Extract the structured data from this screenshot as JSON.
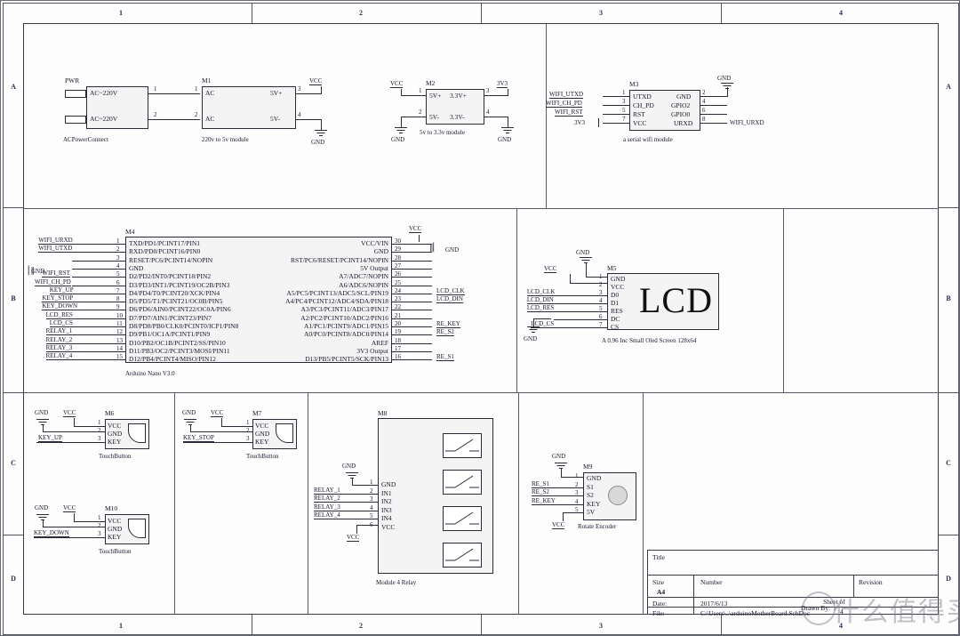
{
  "sheet": {
    "columns": [
      "1",
      "2",
      "3",
      "4"
    ],
    "rows": [
      "A",
      "B",
      "C",
      "D"
    ]
  },
  "blocks": {
    "ac_connector": {
      "refdes": "PWR",
      "caption": "ACPowerConnect",
      "pins": [
        {
          "num": "1",
          "name": "AC~220V"
        },
        {
          "num": "2",
          "name": "AC~220V"
        }
      ]
    },
    "psu_5v": {
      "refdes": "M1",
      "caption": "220v to 5v module",
      "left_pins": [
        {
          "num": "1",
          "name": "AC"
        },
        {
          "num": "2",
          "name": "AC"
        }
      ],
      "right_pins": [
        {
          "num": "3",
          "name": "5V+"
        },
        {
          "num": "4",
          "name": "5V-"
        }
      ],
      "nets": {
        "vcc": "VCC",
        "gnd": "GND"
      }
    },
    "psu_33v": {
      "refdes": "M2",
      "caption": "5v to 3.3v module",
      "left_pins": [
        {
          "num": "1",
          "name": "5V+"
        },
        {
          "num": "2",
          "name": "5V-"
        }
      ],
      "right_pins": [
        {
          "num": "3",
          "name": "3.3V+"
        },
        {
          "num": "4",
          "name": "3.3V-"
        }
      ],
      "nets": {
        "vcc": "VCC",
        "gnd_left": "GND",
        "v33": "3V3",
        "gnd_right": "GND"
      }
    },
    "wifi": {
      "refdes": "M3",
      "caption": "a serial wifi module",
      "left_pins": [
        {
          "num": "1",
          "name": "UTXD",
          "net": "WIFI_UTXD"
        },
        {
          "num": "3",
          "name": "CH_PD",
          "net": "WIFI_CH_PD"
        },
        {
          "num": "5",
          "name": "RST",
          "net": "WIFI_RST"
        },
        {
          "num": "7",
          "name": "VCC",
          "net": "3V3"
        }
      ],
      "right_pins": [
        {
          "num": "2",
          "name": "GND",
          "net": "GND"
        },
        {
          "num": "4",
          "name": "GPIO2",
          "net": ""
        },
        {
          "num": "6",
          "name": "GPIO0",
          "net": ""
        },
        {
          "num": "8",
          "name": "URXD",
          "net": "WIFI_URXD"
        }
      ]
    },
    "arduino": {
      "refdes": "M4",
      "caption": "Arduino Nano V3.0",
      "left_pins": [
        {
          "num": "1",
          "name": "TXD/PD1/PCINT17/PIN1",
          "net": "WIFI_URXD"
        },
        {
          "num": "2",
          "name": "RXD/PD0/PCINT16/PIN0",
          "net": "WIFI_UTXD"
        },
        {
          "num": "3",
          "name": "RESET/PC6/PCINT14/NOPIN",
          "net": ""
        },
        {
          "num": "4",
          "name": "GND",
          "net": ""
        },
        {
          "num": "5",
          "name": "D2/PD2/INT0/PCINT18/PIN2",
          "net": "WIFI_RST"
        },
        {
          "num": "6",
          "name": "D3/PD3/INT1/PCINT19/OC2B/PIN3",
          "net": "WIFI_CH_PD"
        },
        {
          "num": "7",
          "name": "D4/PD4/T0/PCINT20/XCK/PIN4",
          "net": "KEY_UP"
        },
        {
          "num": "8",
          "name": "D5/PD5/T1/PCINT21/OC0B/PIN5",
          "net": "KEY_STOP"
        },
        {
          "num": "9",
          "name": "D6/PD6/AIN0/PCINT22/OC0A/PIN6",
          "net": "KEY_DOWN"
        },
        {
          "num": "10",
          "name": "D7/PD7/AIN1/PCINT23/PIN7",
          "net": "LCD_RES"
        },
        {
          "num": "11",
          "name": "D8/PD8/PB0/CLK0/PCINT0/ICP1/PIN8",
          "net": "LCD_CS"
        },
        {
          "num": "12",
          "name": "D9/PB1/OC1A/PCINT1/PIN9",
          "net": "RELAY_1"
        },
        {
          "num": "13",
          "name": "D10/PB2/OC1B/PCINT2/SS/PIN10",
          "net": "RELAY_2"
        },
        {
          "num": "14",
          "name": "D11/PB3/OC2/PCINT3/MOSI/PIN11",
          "net": "RELAY_3"
        },
        {
          "num": "15",
          "name": "D12/PB4/PCINT4/MISO/PIN12",
          "net": "RELAY_4"
        }
      ],
      "right_pins": [
        {
          "num": "30",
          "name": "VCC/VIN",
          "net": "VCC"
        },
        {
          "num": "29",
          "name": "GND",
          "net": "GND"
        },
        {
          "num": "28",
          "name": "RST/PC6/RESET/PCINT14/NOPIN",
          "net": ""
        },
        {
          "num": "27",
          "name": "5V Output",
          "net": ""
        },
        {
          "num": "26",
          "name": "A7/ADC7/NOPIN",
          "net": ""
        },
        {
          "num": "25",
          "name": "A6/ADC6/NOPIN",
          "net": ""
        },
        {
          "num": "24",
          "name": "A5/PC5/PCINT13/ADC5/SCL/PIN19",
          "net": "LCD_CLK"
        },
        {
          "num": "23",
          "name": "A4/PC4/PCINT12/ADC4/SDA/PIN18",
          "net": "LCD_DIN"
        },
        {
          "num": "22",
          "name": "A3/PC3/PCINT11/ADC3/PIN17",
          "net": ""
        },
        {
          "num": "21",
          "name": "A2/PC2/PCINT10/ADC2/PIN16",
          "net": ""
        },
        {
          "num": "20",
          "name": "A1/PC1/PCINT9/ADC1/PIN15",
          "net": "RE_KEY"
        },
        {
          "num": "19",
          "name": "A0/PC0/PCINT8/ADC0/PIN14",
          "net": "RE_S2"
        },
        {
          "num": "18",
          "name": "AREF",
          "net": ""
        },
        {
          "num": "17",
          "name": "3V3 Output",
          "net": ""
        },
        {
          "num": "16",
          "name": "D13/PB5/PCINT5/SCK/PIN13",
          "net": "RE_S1"
        }
      ],
      "left_port_net": "GND"
    },
    "lcd": {
      "refdes": "M5",
      "caption": "A 0.96 Inc Small Oled Screen 128x64",
      "display_text": "LCD",
      "pins": [
        {
          "num": "1",
          "name": "GND",
          "net": "GND"
        },
        {
          "num": "2",
          "name": "VCC",
          "net": "VCC"
        },
        {
          "num": "3",
          "name": "D0",
          "net": "LCD_CLK"
        },
        {
          "num": "4",
          "name": "D1",
          "net": "LCD_DIN"
        },
        {
          "num": "5",
          "name": "RES",
          "net": "LCD_RES"
        },
        {
          "num": "6",
          "name": "DC",
          "net": ""
        },
        {
          "num": "7",
          "name": "CS",
          "net": "LCD_CS"
        }
      ],
      "gnd_bottom": "GND"
    },
    "key_up": {
      "refdes": "M6",
      "caption": "TouchButton",
      "nets": {
        "gnd": "GND",
        "vcc": "VCC",
        "key": "KEY_UP"
      },
      "pins": [
        {
          "num": "1",
          "name": "VCC"
        },
        {
          "num": "2",
          "name": "GND"
        },
        {
          "num": "3",
          "name": "KEY"
        }
      ]
    },
    "key_stop": {
      "refdes": "M7",
      "caption": "TouchButton",
      "nets": {
        "gnd": "GND",
        "vcc": "VCC",
        "key": "KEY_STOP"
      },
      "pins": [
        {
          "num": "1",
          "name": "VCC"
        },
        {
          "num": "2",
          "name": "GND"
        },
        {
          "num": "3",
          "name": "KEY"
        }
      ]
    },
    "key_down": {
      "refdes": "M10",
      "caption": "TouchButton",
      "nets": {
        "gnd": "GND",
        "vcc": "VCC",
        "key": "KEY_DOWN"
      },
      "pins": [
        {
          "num": "1",
          "name": "VCC"
        },
        {
          "num": "2",
          "name": "GND"
        },
        {
          "num": "3",
          "name": "KEY"
        }
      ]
    },
    "relay": {
      "refdes": "M8",
      "caption": "Module 4 Relay",
      "gnd_label": "GND",
      "vcc_label": "VCC",
      "pins": [
        {
          "num": "1",
          "name": "GND",
          "net": ""
        },
        {
          "num": "2",
          "name": "IN1",
          "net": "RELAY_1"
        },
        {
          "num": "3",
          "name": "IN2",
          "net": "RELAY_2"
        },
        {
          "num": "4",
          "name": "IN3",
          "net": "RELAY_3"
        },
        {
          "num": "5",
          "name": "IN4",
          "net": "RELAY_4"
        },
        {
          "num": "6",
          "name": "VCC",
          "net": ""
        }
      ],
      "relay_count": 4
    },
    "encoder": {
      "refdes": "M9",
      "caption": "Rotate Encoder",
      "gnd_label": "GND",
      "vcc_label": "VCC",
      "pins": [
        {
          "num": "1",
          "name": "GND",
          "net": ""
        },
        {
          "num": "2",
          "name": "S1",
          "net": "RE_S1"
        },
        {
          "num": "3",
          "name": "S2",
          "net": "RE_S2"
        },
        {
          "num": "4",
          "name": "KEY",
          "net": "RE_KEY"
        },
        {
          "num": "5",
          "name": "5V",
          "net": ""
        }
      ]
    }
  },
  "title_block": {
    "title_label": "Title",
    "title_value": "",
    "size_label": "Size",
    "size_value": "A4",
    "number_label": "Number",
    "number_value": "",
    "revision_label": "Revision",
    "revision_value": "",
    "date_label": "Date:",
    "date_value": "2017/6/13",
    "file_label": "File:",
    "file_value": "C:\\Users\\..\\arduinoMotherBoard.SchDoc",
    "drawn_label": "Drawn By:",
    "sheet_of": "Sheet    of",
    "sheet_num": "4"
  },
  "watermark": {
    "text": "什么值得买"
  }
}
